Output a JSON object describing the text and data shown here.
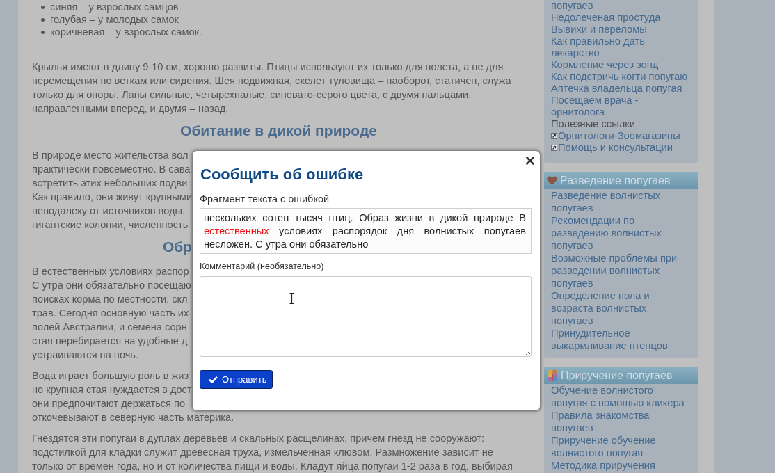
{
  "article": {
    "blocks": [
      {
        "kind": "list",
        "items": [
          "синяя – у взрослых самцов",
          "голубая – у молодых самок",
          "коричневая – у взрослых самок."
        ]
      },
      {
        "kind": "paragraph",
        "text": "Крылья имеют в длину 9-10 см, хорошо развиты. Птицы используют их только для полета, а не для перемещения по веткам или сидения. Шея подвижная, скелет туловища – наоборот, статичен, служа только для опоры. Лапы сильные, четырехпалые, синевато-серого цвета, с двумя пальцами, направленными вперед, и двумя – назад."
      },
      {
        "kind": "heading",
        "text": "Обитание в дикой природе"
      },
      {
        "kind": "covered_paragraph",
        "lines": [
          "В природе место жительства вол",
          "практически повсеместно. В сава",
          "встретить этих небольших подви",
          "Как правило, они живут крупными",
          "неподалеку от источников воды.",
          "гигантские колонии, численность"
        ]
      },
      {
        "kind": "covered_heading",
        "text": "Обр"
      },
      {
        "kind": "covered_paragraph",
        "lines": [
          "В естественных условиях распор",
          "С утра они обязательно посещаю",
          "поисках корма по местности, скл",
          "трав. Сегодня основную часть их",
          "полей Австралии, и семена сорн",
          "стая перебирается на удобные д",
          "устраиваются на ночь."
        ]
      },
      {
        "kind": "covered_paragraph",
        "lines": [
          "Вода играет большую роль в жиз",
          "но крупная стая нуждается в дост",
          "они предпочитают держаться по",
          "откочевывают в северную часть материка."
        ]
      },
      {
        "kind": "paragraph",
        "text": "Гнездятся эти попугаи в дуплах деревьев и скальных расщелинах, причем гнезд не сооружают: подстилкой для кладки служит древесная труха, измельченная клювом. Размножение зависит не только от времен года, но и от количества пищи и воды. Кладут яйца попугаи 1-2 раза в год, выбирая"
      }
    ]
  },
  "sidebar": {
    "panels": [
      {
        "items": [
          {
            "kind": "link",
            "text": "попугаев"
          },
          {
            "kind": "link",
            "text": "Недолеченая простуда"
          },
          {
            "kind": "link",
            "text": "Вывихи и переломы"
          },
          {
            "kind": "link",
            "text": "Как правильно дать лекарство"
          },
          {
            "kind": "link",
            "text": "Кормление через зонд"
          },
          {
            "kind": "link",
            "text": "Как подстричь когти попугаю"
          },
          {
            "kind": "link",
            "text": "Аптечка владельца попугая"
          },
          {
            "kind": "link",
            "text": "Посещаем врача - орнитолога"
          },
          {
            "kind": "label",
            "text": "Полезные ссылки"
          },
          {
            "kind": "external",
            "text": "Орнитологи-Зоомагазины"
          },
          {
            "kind": "external",
            "text": "Помощь и консультации"
          }
        ]
      },
      {
        "title": "Разведение попугаев",
        "items": [
          {
            "kind": "link",
            "text": "Разведение волнистых попугаев"
          },
          {
            "kind": "link",
            "text": "Рекомендации по разведению волнистых попугаев"
          },
          {
            "kind": "link",
            "text": "Возможные проблемы при разведении волнистых попугаев"
          },
          {
            "kind": "link",
            "text": "Определение пола и возраста волнистых попугаев"
          },
          {
            "kind": "link",
            "text": "Принудительное выкармливание птенцов"
          }
        ]
      },
      {
        "title": "Приручение попугаев",
        "items": [
          {
            "kind": "link",
            "text": "Обучение волнистого попугая с помощью кликера"
          },
          {
            "kind": "link",
            "text": "Правила знакомства попугаев"
          },
          {
            "kind": "link",
            "text": "Приручение обучение волнистого попугая"
          },
          {
            "kind": "link",
            "text": "Методика приручения"
          }
        ]
      }
    ]
  },
  "dialog": {
    "title": "Сообщить об ошибке",
    "fragment_label": "Фрагмент текста с ошибкой",
    "fragment": {
      "before": "нескольких сотен тысяч птиц. Образ жизни в дикой природе В",
      "error": "естественных",
      "after": "условиях распорядок дня волнистых попугаев несложен. С утра они обязательно"
    },
    "comment_label": "Комментарий (необязательно)",
    "submit": "Отправить"
  }
}
